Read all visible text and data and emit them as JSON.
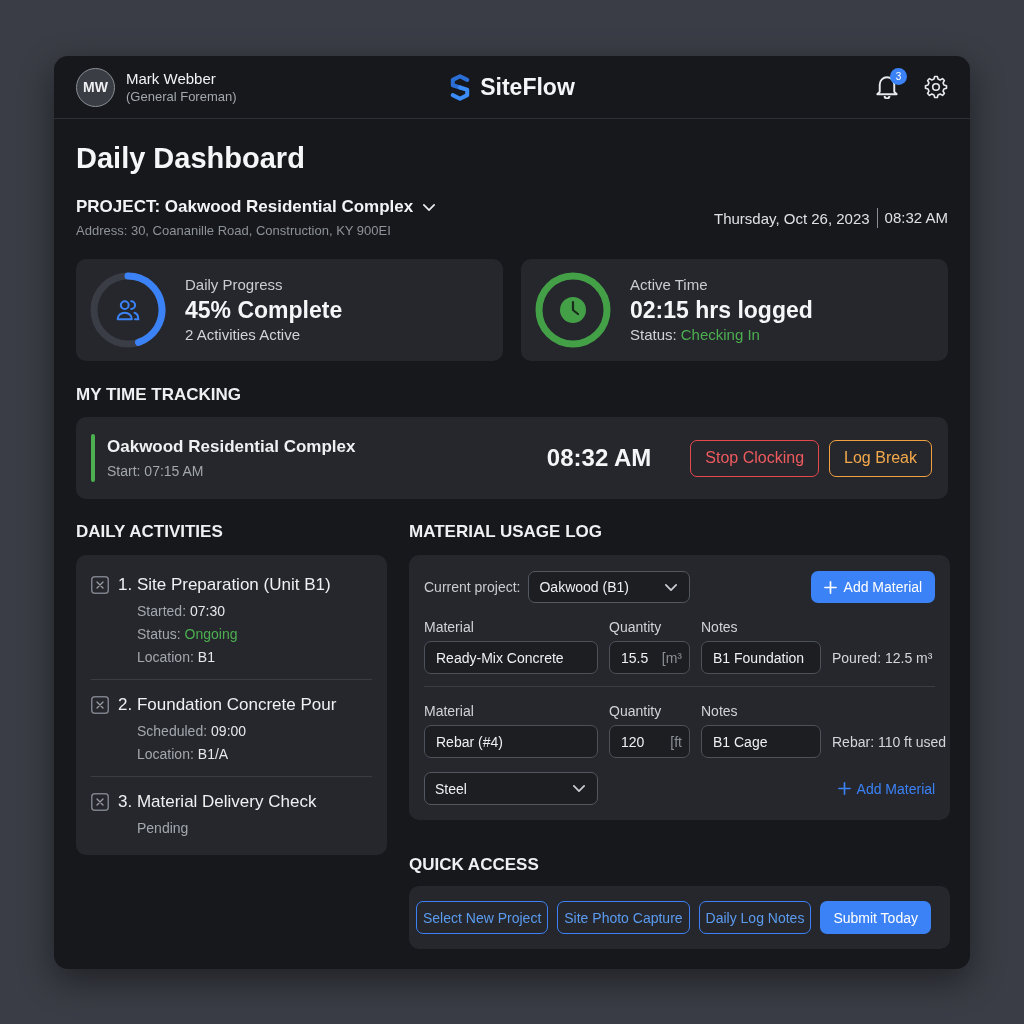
{
  "header": {
    "user": {
      "initials": "MW",
      "name": "Mark Webber",
      "role": "(General Foreman)"
    },
    "brand": "SiteFlow",
    "notifications": {
      "count": "3"
    }
  },
  "page": {
    "title": "Daily Dashboard",
    "project": "PROJECT: Oakwood Residential Complex",
    "address": "Address: 30, Coananille Road, Construction, KY 900EI",
    "date": "Thursday, Oct 26, 2023",
    "time": "08:32 AM"
  },
  "stats": [
    {
      "kind": "progress",
      "label": "Daily Progress",
      "value": "45% Complete",
      "detail": "2 Activities Active",
      "level": 0.45
    },
    {
      "kind": "timer",
      "label": "Active Time",
      "value": "02:15 hrs logged",
      "status": {
        "label": "Status:",
        "value": "Checking In"
      }
    }
  ],
  "time_tracking": {
    "title": "MY TIME TRACKING",
    "project": "Oakwood Residential Complex",
    "start": "Start: 07:15 AM",
    "clock": "08:32 AM",
    "buttons": [
      {
        "label": "Stop Clocking",
        "kind": "danger"
      },
      {
        "label": "Log Break",
        "kind": "warning"
      }
    ]
  },
  "activities": {
    "title": "DAILY ACTIVITIES",
    "items": [
      {
        "title": "1. Site Preparation (Unit B1)",
        "details": [
          {
            "kind": "field",
            "label": "Started:",
            "value": "07:30"
          },
          {
            "kind": "status",
            "label": "Status:",
            "value": "Ongoing"
          },
          {
            "kind": "field",
            "label": "Location:",
            "value": "B1"
          }
        ]
      },
      {
        "title": "2. Foundation Concrete Pour",
        "details": [
          {
            "kind": "field",
            "label": "Scheduled:",
            "value": "09:00"
          },
          {
            "kind": "field",
            "label": "Location:",
            "value": "B1/A"
          }
        ]
      },
      {
        "title": "3. Material Delivery Check",
        "details": [
          {
            "kind": "note",
            "value": "Pending"
          }
        ]
      }
    ]
  },
  "materials": {
    "title": "MATERIAL USAGE LOG",
    "project_label": "Current project:",
    "project_select": "Oakwood (B1)",
    "add_button": {
      "label": "Add Material",
      "kind": "primary"
    },
    "entries": [
      {
        "columns": [
          "Material",
          "Quantity",
          "Notes"
        ],
        "material": "Ready-Mix Concrete",
        "quantity": "15.5",
        "unit": "[m³",
        "notes": "B1 Foundation",
        "summary": "Poured: 12.5 m³"
      },
      {
        "columns": [
          "Material",
          "Quantity",
          "Notes"
        ],
        "material": "Rebar (#4)",
        "quantity": "120",
        "unit": "[ft",
        "notes": "B1 Cage",
        "summary": "Rebar: 110 ft used"
      }
    ],
    "category_select": "Steel",
    "add_link": "Add Material"
  },
  "quick_access": {
    "title": "QUICK ACCESS",
    "buttons": [
      {
        "label": "Select New Project",
        "kind": "outline"
      },
      {
        "label": "Site Photo Capture",
        "kind": "outline"
      },
      {
        "label": "Daily Log Notes",
        "kind": "outline"
      },
      {
        "label": "Submit Today",
        "kind": "primary"
      }
    ]
  }
}
